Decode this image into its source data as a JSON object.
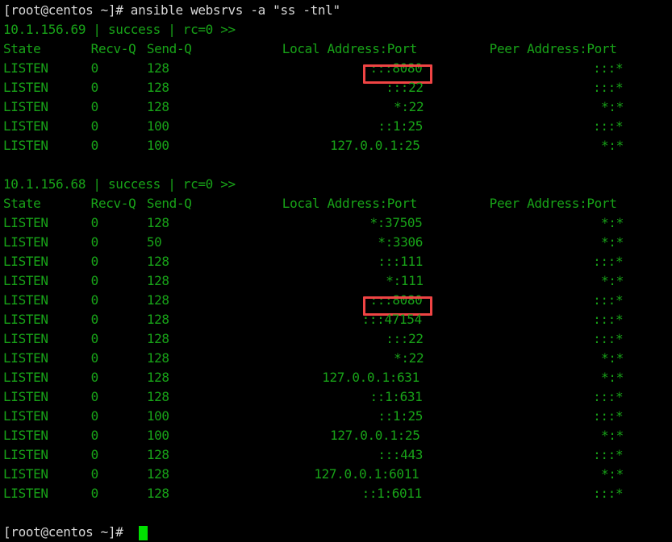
{
  "terminal": {
    "colors": {
      "background": "#000000",
      "prompt_text": "#d8d8d8",
      "output_text": "#18a318",
      "cursor": "#00e000",
      "highlight_box": "#ef4444"
    },
    "command_line": "[root@centos ~]# ansible websrvs -a \"ss -tnl\"",
    "prompt_final": "[root@centos ~]# ",
    "columns": {
      "state": "State",
      "recv_q": "Recv-Q",
      "send_q": "Send-Q",
      "local_address": "Local Address:Port",
      "peer_address": "Peer Address:Port"
    },
    "blocks": [
      {
        "header": "10.1.156.69 | success | rc=0 >>",
        "host": "10.1.156.69",
        "status": "success",
        "rc": "rc=0",
        "rows": [
          {
            "state": "LISTEN",
            "recv_q": "0",
            "send_q": "128",
            "local": ":::8080",
            "peer": ":::*",
            "highlight": true
          },
          {
            "state": "LISTEN",
            "recv_q": "0",
            "send_q": "128",
            "local": ":::22",
            "peer": ":::*",
            "highlight": false
          },
          {
            "state": "LISTEN",
            "recv_q": "0",
            "send_q": "128",
            "local": "*:22",
            "peer": "*:*",
            "highlight": false
          },
          {
            "state": "LISTEN",
            "recv_q": "0",
            "send_q": "100",
            "local": "::1:25",
            "peer": ":::*",
            "highlight": false
          },
          {
            "state": "LISTEN",
            "recv_q": "0",
            "send_q": "100",
            "local": "127.0.0.1:25",
            "peer": "*:*",
            "highlight": false
          }
        ]
      },
      {
        "header": "10.1.156.68 | success | rc=0 >>",
        "host": "10.1.156.68",
        "status": "success",
        "rc": "rc=0",
        "rows": [
          {
            "state": "LISTEN",
            "recv_q": "0",
            "send_q": "128",
            "local": "*:37505",
            "peer": "*:*",
            "highlight": false
          },
          {
            "state": "LISTEN",
            "recv_q": "0",
            "send_q": "50",
            "local": "*:3306",
            "peer": "*:*",
            "highlight": false
          },
          {
            "state": "LISTEN",
            "recv_q": "0",
            "send_q": "128",
            "local": ":::111",
            "peer": ":::*",
            "highlight": false
          },
          {
            "state": "LISTEN",
            "recv_q": "0",
            "send_q": "128",
            "local": "*:111",
            "peer": "*:*",
            "highlight": false
          },
          {
            "state": "LISTEN",
            "recv_q": "0",
            "send_q": "128",
            "local": ":::8080",
            "peer": ":::*",
            "highlight": true
          },
          {
            "state": "LISTEN",
            "recv_q": "0",
            "send_q": "128",
            "local": ":::47154",
            "peer": ":::*",
            "highlight": false
          },
          {
            "state": "LISTEN",
            "recv_q": "0",
            "send_q": "128",
            "local": ":::22",
            "peer": ":::*",
            "highlight": false
          },
          {
            "state": "LISTEN",
            "recv_q": "0",
            "send_q": "128",
            "local": "*:22",
            "peer": "*:*",
            "highlight": false
          },
          {
            "state": "LISTEN",
            "recv_q": "0",
            "send_q": "128",
            "local": "127.0.0.1:631",
            "peer": "*:*",
            "highlight": false
          },
          {
            "state": "LISTEN",
            "recv_q": "0",
            "send_q": "128",
            "local": "::1:631",
            "peer": ":::*",
            "highlight": false
          },
          {
            "state": "LISTEN",
            "recv_q": "0",
            "send_q": "100",
            "local": "::1:25",
            "peer": ":::*",
            "highlight": false
          },
          {
            "state": "LISTEN",
            "recv_q": "0",
            "send_q": "100",
            "local": "127.0.0.1:25",
            "peer": "*:*",
            "highlight": false
          },
          {
            "state": "LISTEN",
            "recv_q": "0",
            "send_q": "128",
            "local": ":::443",
            "peer": ":::*",
            "highlight": false
          },
          {
            "state": "LISTEN",
            "recv_q": "0",
            "send_q": "128",
            "local": "127.0.0.1:6011",
            "peer": "*:*",
            "highlight": false
          },
          {
            "state": "LISTEN",
            "recv_q": "0",
            "send_q": "128",
            "local": "::1:6011",
            "peer": ":::*",
            "highlight": false
          }
        ]
      }
    ]
  }
}
